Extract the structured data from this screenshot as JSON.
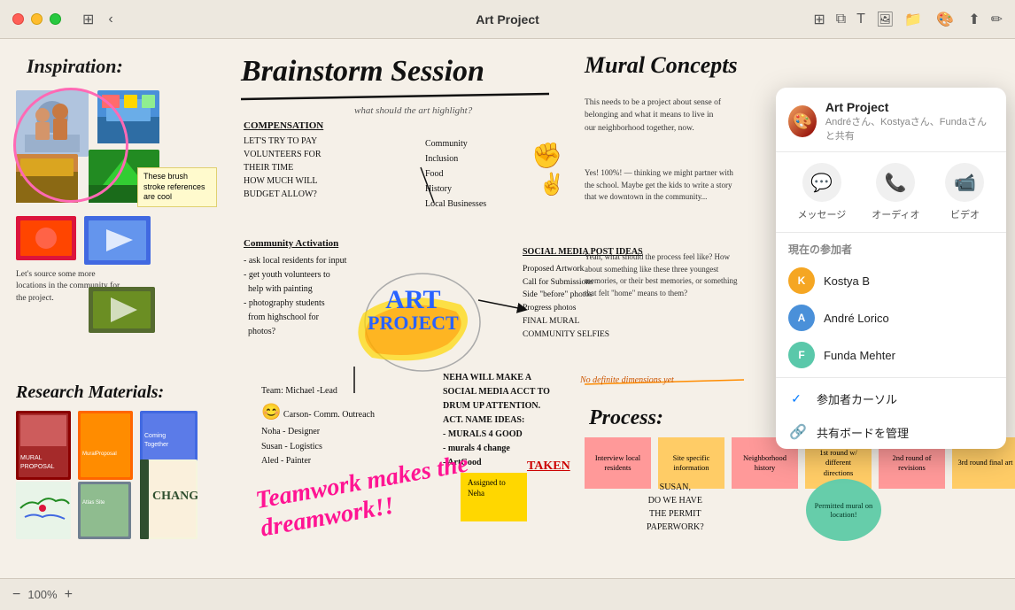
{
  "window": {
    "title": "Art Project"
  },
  "titlebar": {
    "back_label": "‹",
    "title": "Art Project",
    "toolbar_icons": [
      "grid-icon",
      "copy-icon",
      "text-icon",
      "image-icon",
      "folder-icon"
    ],
    "zoom_level": "100%",
    "zoom_minus": "−",
    "zoom_plus": "+"
  },
  "collab_panel": {
    "title": "Art Project",
    "subtitle": "Andréさん、Kostyaさん、Fundaさんと共有",
    "actions": [
      {
        "icon": "💬",
        "label": "メッセージ"
      },
      {
        "icon": "📞",
        "label": "オーディオ"
      },
      {
        "icon": "📹",
        "label": "ビデオ"
      }
    ],
    "participants_header": "現在の参加者",
    "participants": [
      {
        "name": "Kostya B",
        "color": "pa-yellow",
        "initial": "K"
      },
      {
        "name": "André Lorico",
        "color": "pa-blue",
        "initial": "A"
      },
      {
        "name": "Funda Mehter",
        "color": "pa-teal",
        "initial": "F"
      }
    ],
    "options": [
      {
        "icon": "✅",
        "label": "参加者カーソル"
      },
      {
        "icon": "🔗",
        "label": "共有ボードを管理"
      }
    ]
  },
  "canvas": {
    "inspiration_label": "Inspiration:",
    "brainstorm_title": "Brainstorm Session",
    "mural_title": "Mural Concepts",
    "art_project": "ART PROJECT",
    "research_label": "Research Materials:",
    "process_label": "Process:",
    "teamwork_text": "Teamwork makes the dreamwork!!",
    "change_label": "CHANGE"
  }
}
